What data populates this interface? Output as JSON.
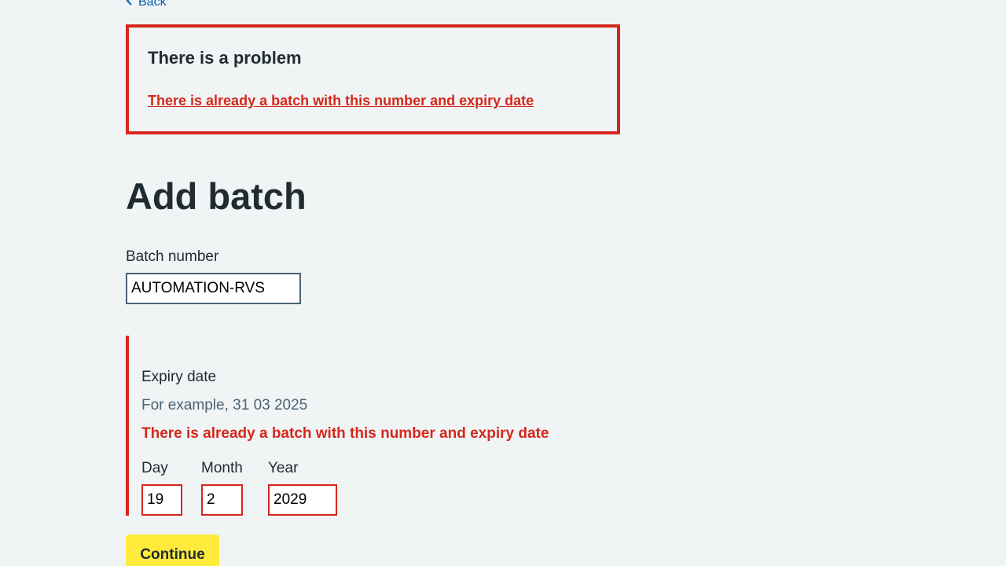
{
  "nav": {
    "back_label": "Back",
    "back_icon": "chevron-left-icon"
  },
  "error_summary": {
    "title": "There is a problem",
    "link_text": "There is already a batch with this number and expiry date"
  },
  "page": {
    "title": "Add batch"
  },
  "batch_number": {
    "label": "Batch number",
    "value": "AUTOMATION-RVS"
  },
  "expiry_date": {
    "label": "Expiry date",
    "hint": "For example, 31 03 2025",
    "error": "There is already a batch with this number and expiry date",
    "day": {
      "label": "Day",
      "value": "19"
    },
    "month": {
      "label": "Month",
      "value": "2"
    },
    "year": {
      "label": "Year",
      "value": "2029"
    }
  },
  "actions": {
    "continue_label": "Continue"
  },
  "colors": {
    "background": "#f0f4f5",
    "error": "#d5281b",
    "link": "#005eb8",
    "text": "#212b32",
    "hint": "#4c6272",
    "button": "#ffeb3b"
  }
}
